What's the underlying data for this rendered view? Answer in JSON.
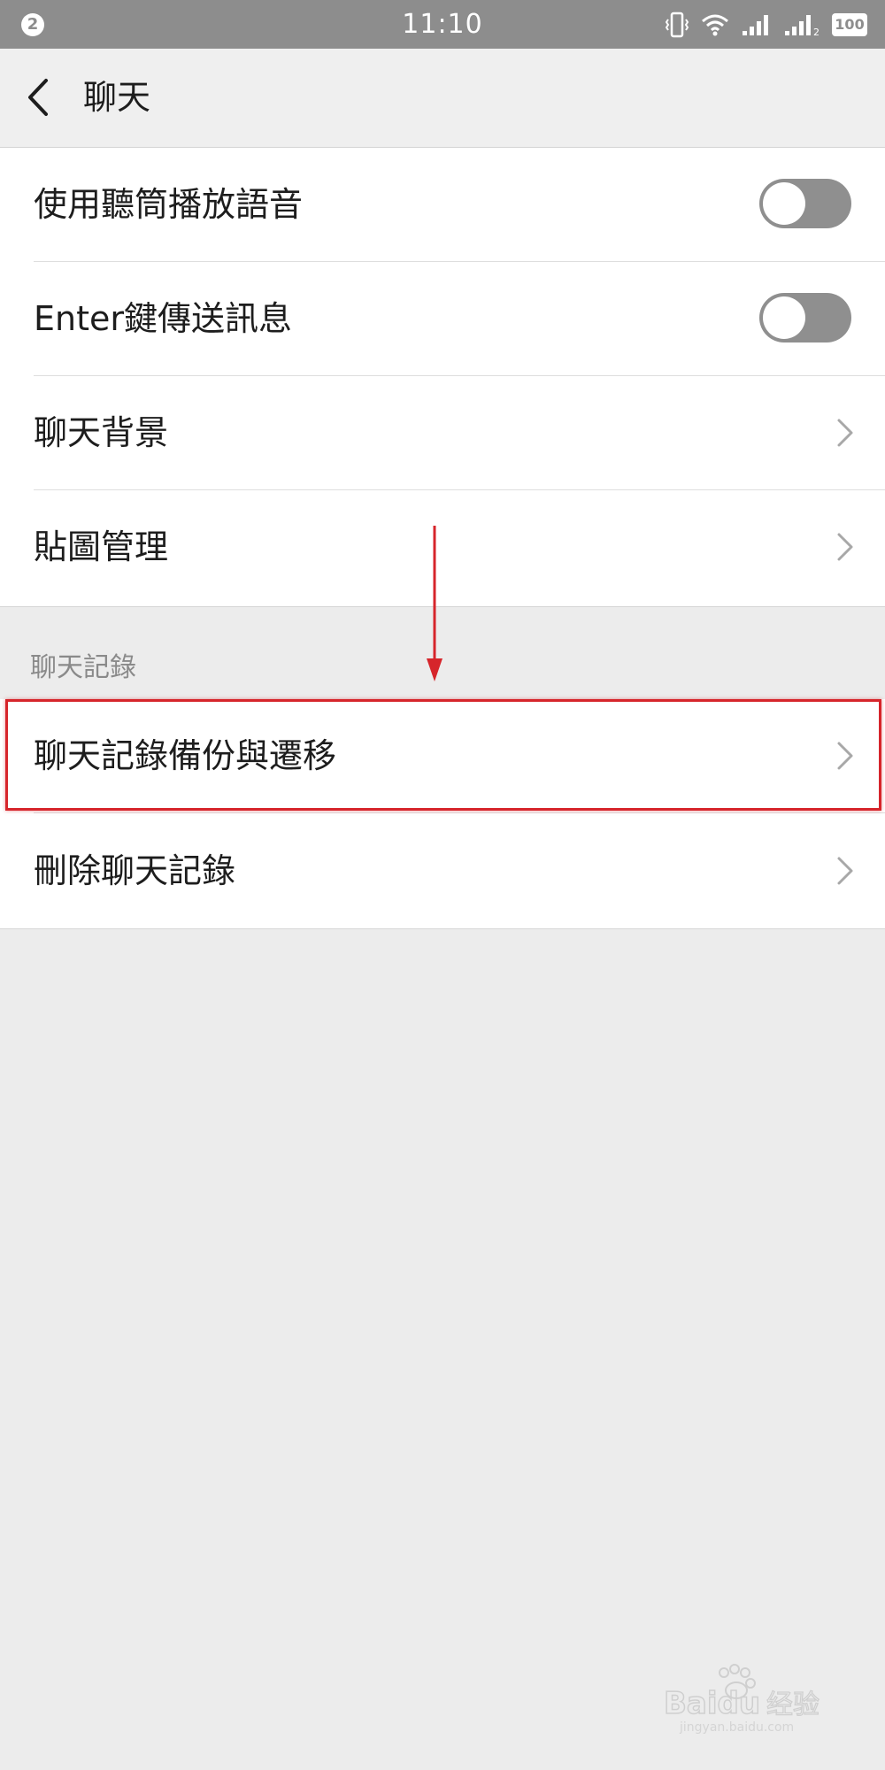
{
  "status_bar": {
    "notification_count": "2",
    "time": "11:10",
    "battery": "100",
    "sim2_label": "2"
  },
  "header": {
    "title": "聊天"
  },
  "settings": {
    "earpiece_label": "使用聽筒播放語音",
    "earpiece_enabled": false,
    "enter_send_label": "Enter鍵傳送訊息",
    "enter_send_enabled": false,
    "chat_background_label": "聊天背景",
    "sticker_management_label": "貼圖管理"
  },
  "chat_history": {
    "section_title": "聊天記錄",
    "backup_migrate_label": "聊天記錄備份與遷移",
    "delete_label": "刪除聊天記錄"
  },
  "watermark": {
    "brand": "Baidu",
    "brand_cn": "经验",
    "domain": "jingyan.baidu.com"
  },
  "colors": {
    "status_bar": "#8d8d8d",
    "toggle_off": "#8f8f8f",
    "annotation_red": "#d6252b",
    "background": "#ececec"
  }
}
